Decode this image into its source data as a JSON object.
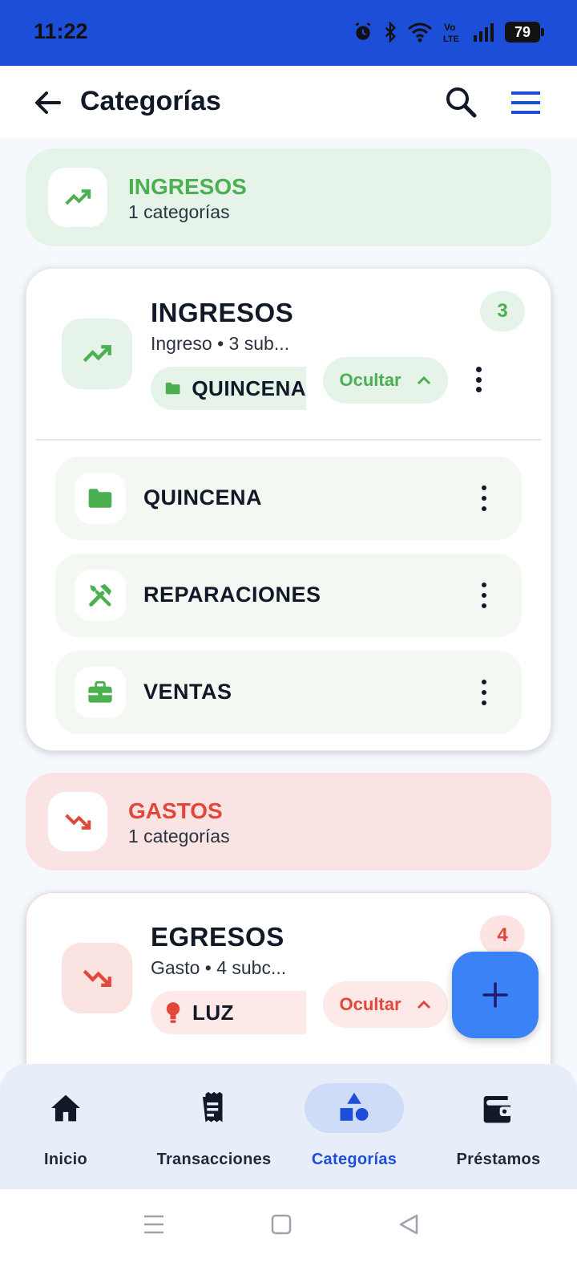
{
  "status_bar": {
    "time": "11:22",
    "battery": "79"
  },
  "app_bar": {
    "title": "Categorías"
  },
  "income_header": {
    "title": "INGRESOS",
    "count": "1 categorías",
    "color": "#4caf50",
    "bg": "#e6f3e8"
  },
  "income_card": {
    "name": "INGRESOS",
    "subtitle": "Ingreso • 3 sub...",
    "badge": "3",
    "chip_label": "QUINCENA",
    "toggle_label": "Ocultar",
    "subcategories": [
      {
        "name": "QUINCENA",
        "icon": "folder-icon"
      },
      {
        "name": "REPARACIONES",
        "icon": "tools-icon"
      },
      {
        "name": "VENTAS",
        "icon": "briefcase-icon"
      }
    ]
  },
  "expense_header": {
    "title": "GASTOS",
    "count": "1 categorías",
    "color": "#e2473b",
    "bg": "#f9e3e3"
  },
  "expense_card": {
    "name": "EGRESOS",
    "subtitle": "Gasto • 4 subc...",
    "badge": "4",
    "chip_label": "LUZ",
    "toggle_label": "Ocultar"
  },
  "bottom_nav": [
    {
      "label": "Inicio",
      "icon": "home-icon"
    },
    {
      "label": "Transacciones",
      "icon": "receipt-icon"
    },
    {
      "label": "Categorías",
      "icon": "shapes-icon",
      "active": true
    },
    {
      "label": "Préstamos",
      "icon": "wallet-icon"
    }
  ],
  "colors": {
    "primary": "#1d4ed8",
    "fab": "#3b82f6",
    "income": "#4caf50",
    "expense": "#e2473b"
  }
}
